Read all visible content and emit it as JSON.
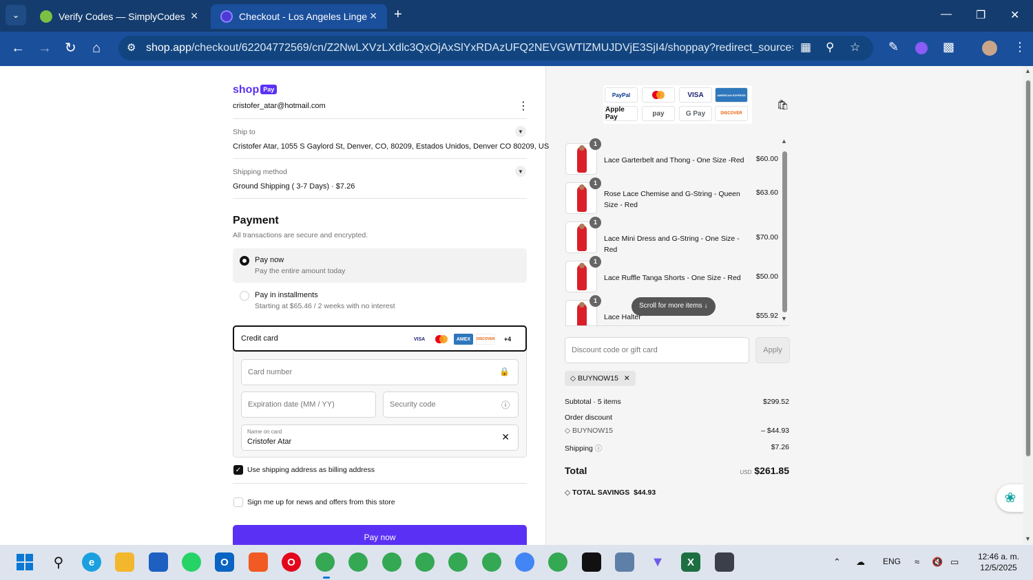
{
  "browser": {
    "tabs": [
      {
        "title": "Verify Codes — SimplyCodes",
        "active": false
      },
      {
        "title": "Checkout - Los Angeles Lingerie",
        "active": true
      }
    ],
    "url_host": "shop.app",
    "url_path": "/checkout/62204772569/cn/Z2NwLXVzLXdlc3QxOjAxSlYxRDAzUFQ2NEVGWTlZMUJDVjE3SjI4/shoppay?redirect_source=checko..."
  },
  "checkout": {
    "logo_text": "shop",
    "logo_badge": "Pay",
    "email": "cristofer_atar@hotmail.com",
    "ship_to_label": "Ship to",
    "ship_to_value": "Cristofer Atar, 1055 S Gaylord St, Denver, CO, 80209, Estados Unidos, Denver CO 80209, US",
    "shipping_method_label": "Shipping method",
    "shipping_method_value": "Ground Shipping ( 3-7 Days) · $7.26",
    "payment_title": "Payment",
    "payment_subtitle": "All transactions are secure and encrypted.",
    "options": [
      {
        "title": "Pay now",
        "subtitle": "Pay the entire amount today",
        "selected": true
      },
      {
        "title": "Pay in installments",
        "subtitle": "Starting at $65.46 / 2 weeks with no interest",
        "selected": false
      }
    ],
    "credit_card_label": "Credit card",
    "card_logos": [
      "VISA",
      "MC",
      "AMEX",
      "DISCOVER",
      "+4"
    ],
    "card_number_placeholder": "Card number",
    "expiration_placeholder": "Expiration date (MM / YY)",
    "security_placeholder": "Security code",
    "name_label": "Name on card",
    "name_value": "Cristofer Atar",
    "billing_checkbox": {
      "label": "Use shipping address as billing address",
      "checked": true
    },
    "news_checkbox": {
      "label": "Sign me up for news and offers from this store",
      "checked": false
    },
    "pay_button": "Pay now"
  },
  "wallets": [
    "PayPal",
    "Mastercard",
    "VISA",
    "AMERICAN EXPRESS",
    "Apple Pay",
    "pay",
    "G Pay",
    "DISCOVER"
  ],
  "items": [
    {
      "qty": "1",
      "name": "Lace Garterbelt and Thong - One Size -Red",
      "price": "$60.00"
    },
    {
      "qty": "1",
      "name": "Rose Lace Chemise and G-String - Queen Size - Red",
      "price": "$63.60"
    },
    {
      "qty": "1",
      "name": "Lace Mini Dress and G-String - One Size - Red",
      "price": "$70.00"
    },
    {
      "qty": "1",
      "name": "Lace Ruffle Tanga Shorts - One Size - Red",
      "price": "$50.00"
    },
    {
      "qty": "1",
      "name": "Lace Halter",
      "price": "$55.92"
    }
  ],
  "scroll_hint": "Scroll for more items",
  "discount": {
    "placeholder": "Discount code or gift card",
    "apply_label": "Apply",
    "applied_code": "BUYNOW15"
  },
  "summary": {
    "subtotal_label": "Subtotal · 5 items",
    "subtotal_value": "$299.52",
    "order_discount_label": "Order discount",
    "discount_code": "BUYNOW15",
    "discount_value": "– $44.93",
    "shipping_label": "Shipping",
    "shipping_value": "$7.26",
    "total_label": "Total",
    "currency": "USD",
    "total_value": "$261.85",
    "savings_label": "TOTAL SAVINGS",
    "savings_value": "$44.93"
  },
  "taskbar": {
    "lang": "ENG",
    "time": "12:46 a. m.",
    "date": "12/5/2025"
  }
}
